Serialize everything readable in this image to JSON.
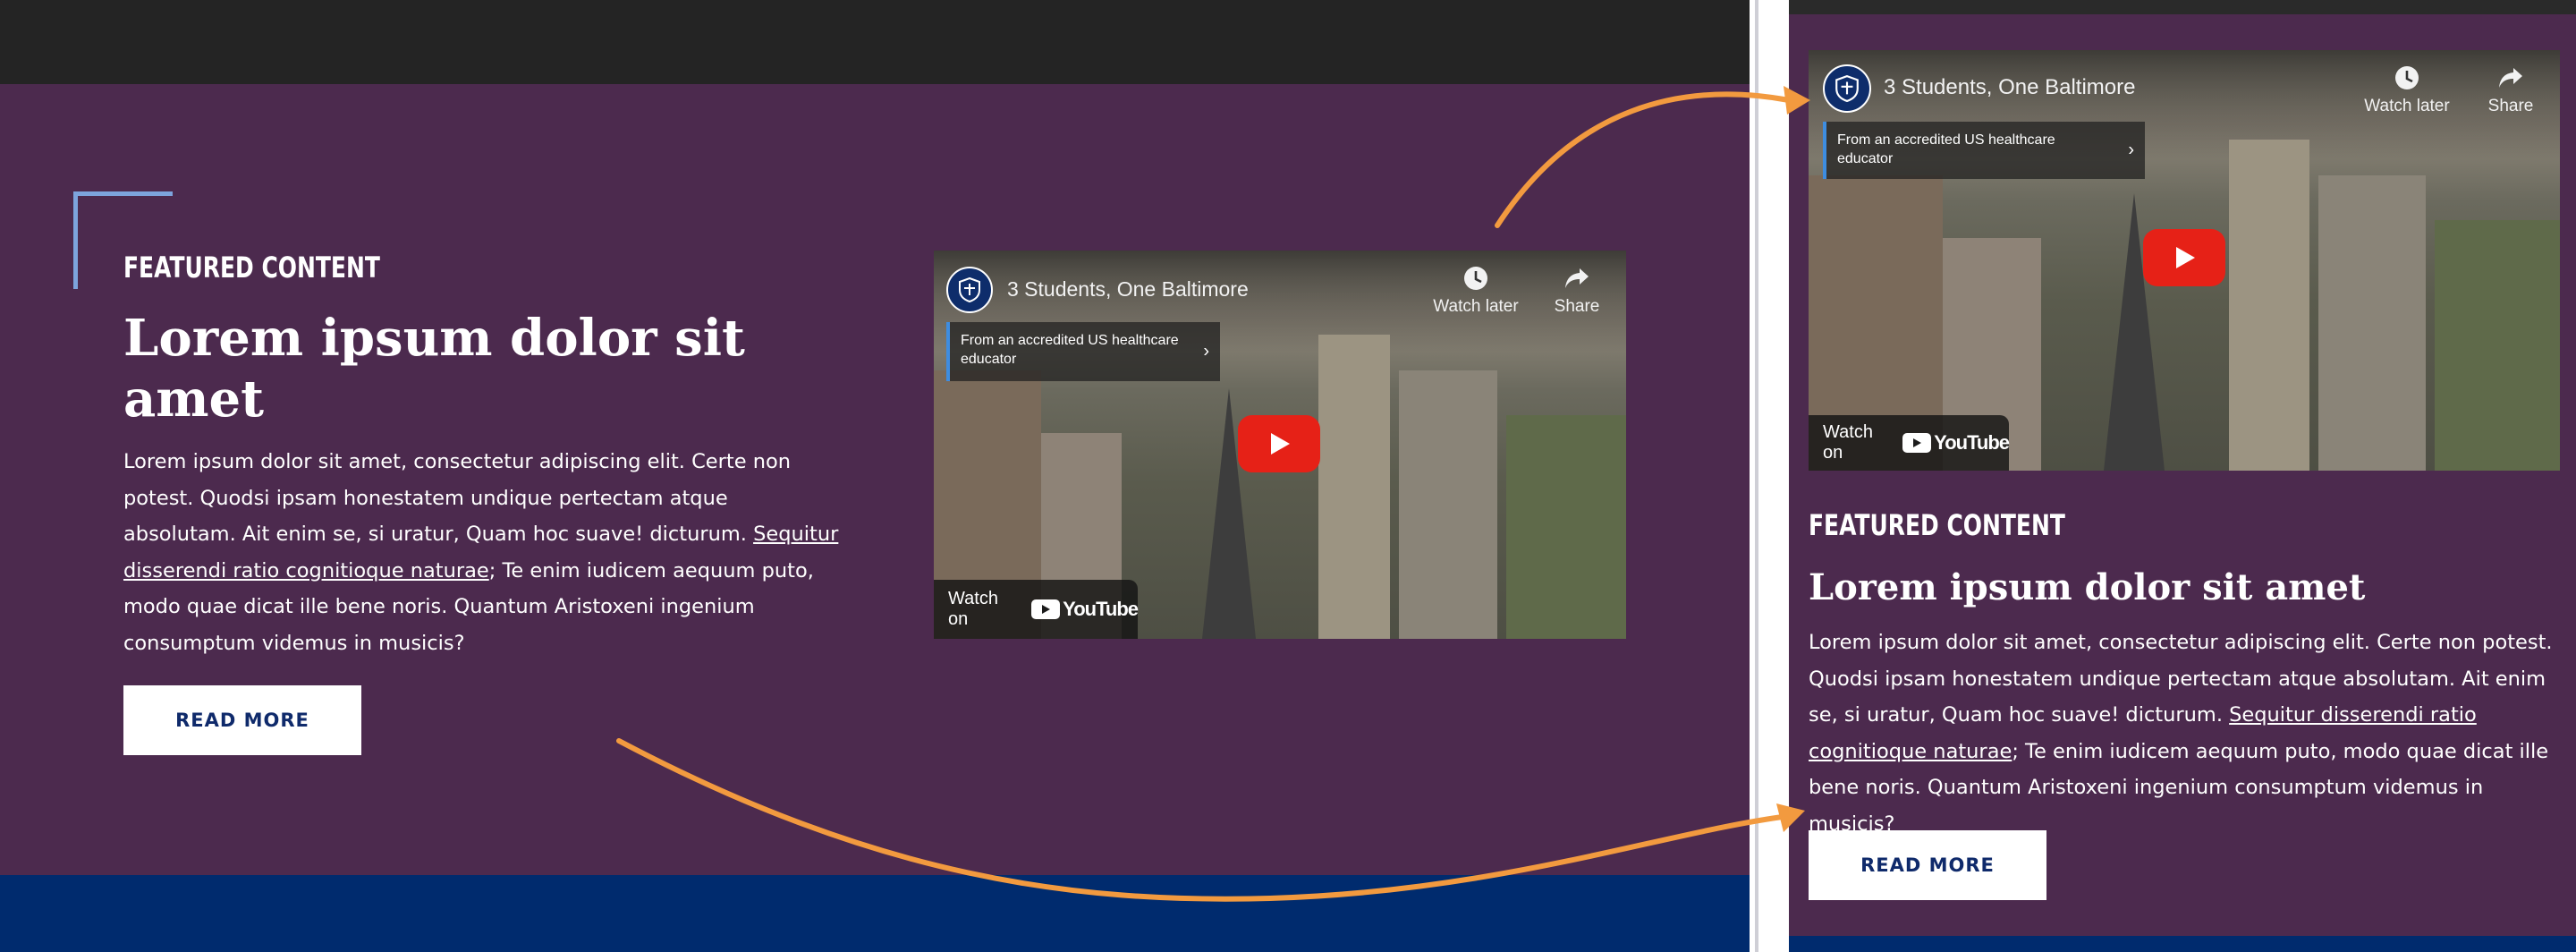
{
  "section": {
    "eyebrow": "FEATURED CONTENT",
    "headline": "Lorem ipsum dolor sit amet",
    "body_before_link": "Lorem ipsum dolor sit amet, consectetur adipiscing elit. Certe non potest. Quodsi ipsam honestatem undique pertectam atque absolutam. Ait enim se, si uratur, Quam hoc suave! dicturum. ",
    "body_link": "Sequitur disserendi ratio cognitioque naturae",
    "body_after_link": "; Te enim iudicem aequum puto, modo quae dicat ille bene noris. Quantum Aristoxeni ingenium consumptum videmus in musicis?",
    "cta_label": "READ MORE"
  },
  "video": {
    "title": "3 Students, One Baltimore",
    "watch_later_label": "Watch later",
    "share_label": "Share",
    "info_card_text": "From an accredited US healthcare educator",
    "watch_on_label": "Watch on",
    "youtube_wordmark": "YouTube"
  },
  "colors": {
    "section_bg": "#4c2a4e",
    "header_bg": "#242424",
    "footer_bg": "#002b6e",
    "accent_bracket": "#7da4dd",
    "annotation_arrow": "#f29a3f",
    "play_red": "#e62117",
    "button_text": "#0f2a6b"
  },
  "icons": {
    "clock": "clock-icon",
    "share": "share-arrow-icon",
    "play": "play-icon",
    "chevron": "chevron-right-icon",
    "channel": "university-shield-icon",
    "youtube": "youtube-logo-icon"
  }
}
